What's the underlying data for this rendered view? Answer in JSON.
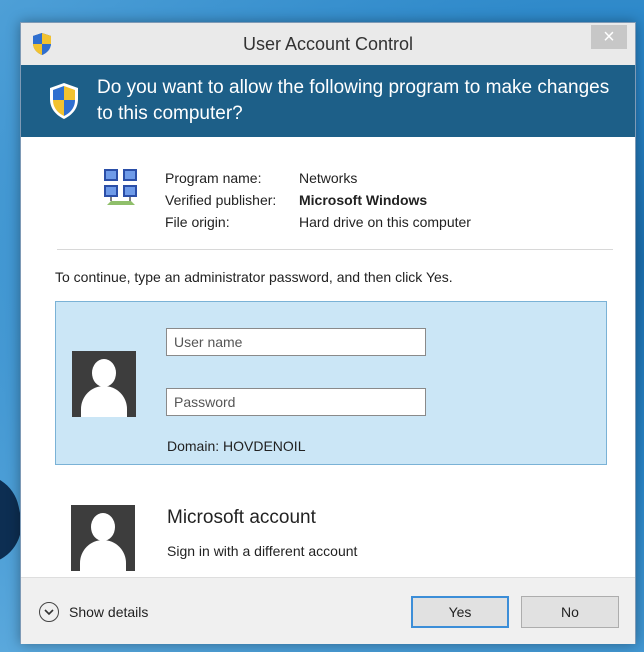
{
  "window": {
    "title": "User Account Control",
    "close_glyph": "×"
  },
  "header": {
    "question": "Do you want to allow the following program to make changes to this computer?"
  },
  "program": {
    "icon": "networks-icon",
    "rows": [
      {
        "label": "Program name:",
        "value": "Networks",
        "bold": false
      },
      {
        "label": "Verified publisher:",
        "value": "Microsoft Windows",
        "bold": true
      },
      {
        "label": "File origin:",
        "value": "Hard drive on this computer",
        "bold": false
      }
    ]
  },
  "instruction": "To continue, type an administrator password, and then click Yes.",
  "credentials": {
    "username_placeholder": "User name",
    "password_placeholder": "Password",
    "domain": "Domain: HOVDENOIL"
  },
  "microsoft_account": {
    "title": "Microsoft account",
    "subtitle": "Sign in with a different account"
  },
  "footer": {
    "show_details": "Show details",
    "yes": "Yes",
    "no": "No"
  },
  "colors": {
    "header_bg": "#1d5f88",
    "selected_account_bg": "#cbe6f6",
    "default_button_border": "#3c8ed8"
  }
}
